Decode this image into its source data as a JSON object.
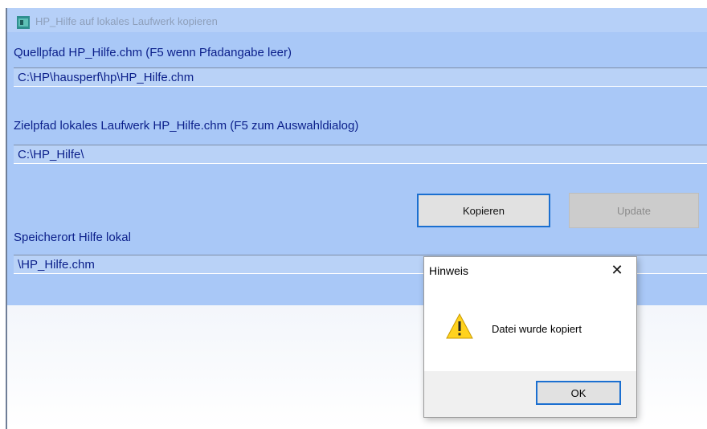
{
  "window": {
    "title": "HP_Hilfe auf lokales Laufwerk kopieren"
  },
  "source": {
    "label": "Quellpfad HP_Hilfe.chm (F5 wenn Pfadangabe leer)",
    "value": "C:\\HP\\hausperf\\hp\\HP_Hilfe.chm"
  },
  "target": {
    "label": "Zielpfad lokales Laufwerk HP_Hilfe.chm (F5 zum Auswahldialog)",
    "value": "C:\\HP_Hilfe\\"
  },
  "buttons": {
    "kopieren": "Kopieren",
    "update": "Update"
  },
  "local": {
    "label": "Speicherort Hilfe lokal",
    "value": "\\HP_Hilfe.chm"
  },
  "dialog": {
    "title": "Hinweis",
    "close": "✕",
    "message": "Datei wurde kopiert",
    "ok": "OK"
  },
  "colors": {
    "form_bg": "#a9c8f7",
    "label_text": "#0b1f8a",
    "focus_border": "#1b6fd0"
  },
  "icons": {
    "app": "app-icon",
    "warning": "warning-icon"
  }
}
